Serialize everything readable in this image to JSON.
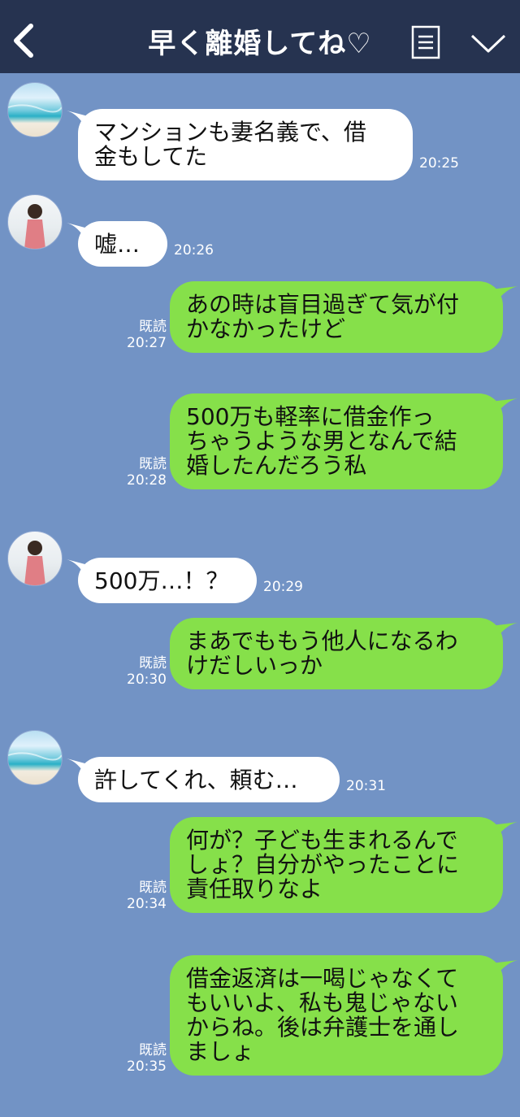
{
  "header": {
    "title": "早く離婚してね♡",
    "back_icon": "chevron-left-icon",
    "memo_icon": "memo-icon",
    "menu_icon": "chevron-down-icon"
  },
  "colors": {
    "header_bg": "#263350",
    "chat_bg": "#7293c5",
    "incoming_bubble": "#ffffff",
    "outgoing_bubble": "#86e04a"
  },
  "messages": [
    {
      "side": "left",
      "avatar": "sea",
      "text": "マンションも妻名義で、借\n金もしてた",
      "time": "20:25"
    },
    {
      "side": "left",
      "avatar": "woman",
      "text": "嘘…",
      "time": "20:26"
    },
    {
      "side": "right",
      "read": "既読",
      "text": "あの時は盲目過ぎて気が付\nかなかったけど",
      "time": "20:27"
    },
    {
      "side": "right",
      "read": "既読",
      "text": "500万も軽率に借金作っ\nちゃうような男となんで結\n婚したんだろう私",
      "time": "20:28"
    },
    {
      "side": "left",
      "avatar": "woman",
      "text": "500万…！？",
      "time": "20:29"
    },
    {
      "side": "right",
      "read": "既読",
      "text": "まあでももう他人になるわ\nけだしいっか",
      "time": "20:30"
    },
    {
      "side": "left",
      "avatar": "sea",
      "text": "許してくれ、頼む…",
      "time": "20:31"
    },
    {
      "side": "right",
      "read": "既読",
      "text": "何が？子ども生まれるんで\nしょ？自分がやったことに\n責任取りなよ",
      "time": "20:34"
    },
    {
      "side": "right",
      "read": "既読",
      "text": "借金返済は一喝じゃなくて\nもいいよ、私も鬼じゃない\nからね。後は弁護士を通し\nましょ",
      "time": "20:35"
    }
  ]
}
